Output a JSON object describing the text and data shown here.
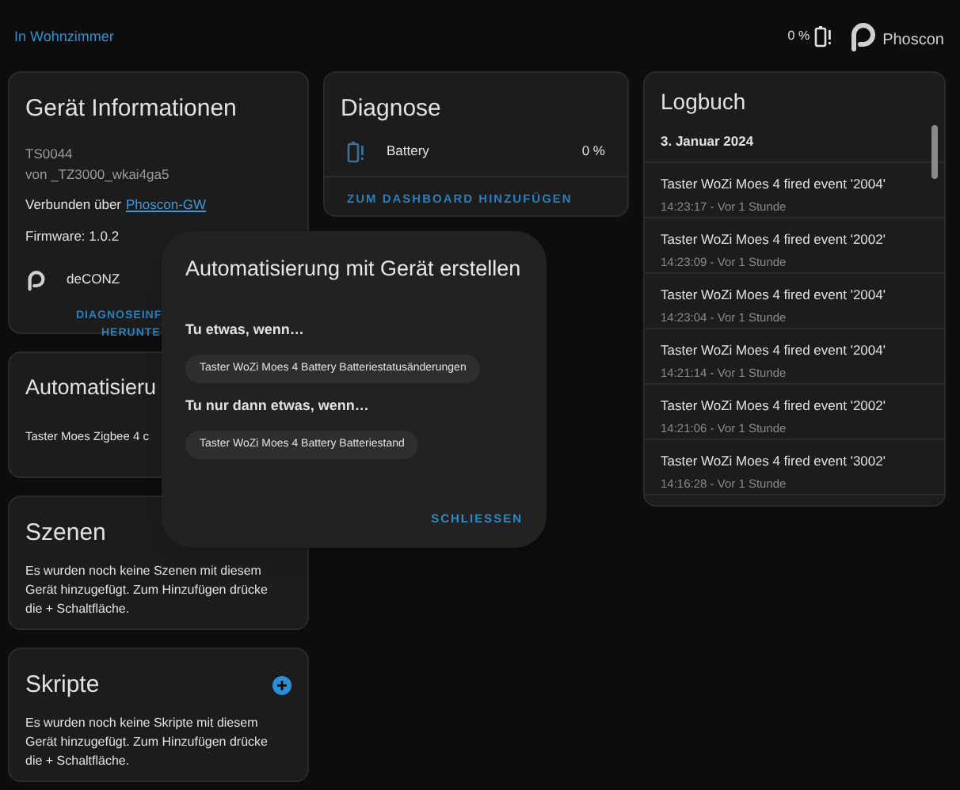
{
  "header": {
    "breadcrumb": "In Wohnzimmer",
    "battery_reading": "0 %",
    "brand": "Phoscon"
  },
  "device_info": {
    "title": "Gerät Informationen",
    "model": "TS0044",
    "manufacturer": "von _TZ3000_wkai4ga5",
    "connected_prefix": "Verbunden über",
    "connected_link": "Phoscon-GW",
    "firmware": "Firmware: 1.0.2",
    "integration": "deCONZ",
    "download_lines": [
      "DIAGNOSEINF",
      "HERUNTE"
    ]
  },
  "automations": {
    "title": "Automatisieru",
    "text": "Taster Moes Zigbee 4 c"
  },
  "scenes": {
    "title": "Szenen",
    "text": "Es wurden noch keine Szenen mit diesem Gerät hinzugefügt. Zum Hinzufügen drücke die + Schaltfläche."
  },
  "scripts": {
    "title": "Skripte",
    "text": "Es wurden noch keine Skripte mit diesem Gerät hinzugefügt. Zum Hinzufügen drücke die + Schaltfläche."
  },
  "diagnostics": {
    "title": "Diagnose",
    "entity": "Battery",
    "reading": "0 %",
    "action": "ZUM DASHBOARD HINZUFÜGEN"
  },
  "logbook": {
    "title": "Logbuch",
    "date": "3. Januar 2024",
    "entries": [
      {
        "message": "Taster WoZi Moes 4 fired event '2004'",
        "time": "14:23:17 - Vor 1 Stunde"
      },
      {
        "message": "Taster WoZi Moes 4 fired event '2002'",
        "time": "14:23:09 - Vor 1 Stunde"
      },
      {
        "message": "Taster WoZi Moes 4 fired event '2004'",
        "time": "14:23:04 - Vor 1 Stunde"
      },
      {
        "message": "Taster WoZi Moes 4 fired event '2004'",
        "time": "14:21:14 - Vor 1 Stunde"
      },
      {
        "message": "Taster WoZi Moes 4 fired event '2002'",
        "time": "14:21:06 - Vor 1 Stunde"
      },
      {
        "message": "Taster WoZi Moes 4 fired event '3002'",
        "time": "14:16:28 - Vor 1 Stunde"
      }
    ]
  },
  "dialog": {
    "title": "Automatisierung mit Gerät erstellen",
    "sections": [
      {
        "heading": "Tu etwas, wenn…",
        "chip": "Taster WoZi Moes 4 Battery Batteriestatusänderungen"
      },
      {
        "heading": "Tu nur dann etwas, wenn…",
        "chip": "Taster WoZi Moes 4 Battery Batteriestand"
      }
    ],
    "close": "SCHLIESSEN"
  }
}
